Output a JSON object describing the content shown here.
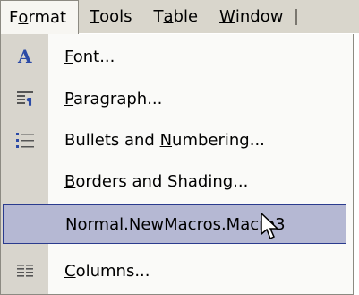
{
  "menubar": {
    "items": [
      {
        "pre": "F",
        "mn": "o",
        "post": "rmat"
      },
      {
        "pre": "",
        "mn": "T",
        "post": "ools"
      },
      {
        "pre": "T",
        "mn": "a",
        "post": "ble"
      },
      {
        "pre": "",
        "mn": "W",
        "post": "indow"
      }
    ]
  },
  "menu": {
    "items": [
      {
        "pre": "",
        "mn": "F",
        "post": "ont...",
        "icon": "font-icon"
      },
      {
        "pre": "",
        "mn": "P",
        "post": "aragraph...",
        "icon": "paragraph-icon"
      },
      {
        "pre": "Bullets and ",
        "mn": "N",
        "post": "umbering...",
        "icon": "bullets-icon"
      },
      {
        "pre": "",
        "mn": "B",
        "post": "orders and Shading...",
        "icon": ""
      },
      {
        "pre": "Normal.NewMacros.Macro3",
        "mn": "",
        "post": "",
        "icon": ""
      },
      {
        "pre": "",
        "mn": "C",
        "post": "olumns...",
        "icon": "columns-icon"
      }
    ]
  },
  "colors": {
    "menubar_bg": "#d9d6cc",
    "gutter_bg": "#d8d5cd",
    "highlight_bg": "#b5b8d3",
    "highlight_border": "#2a3b8e"
  }
}
